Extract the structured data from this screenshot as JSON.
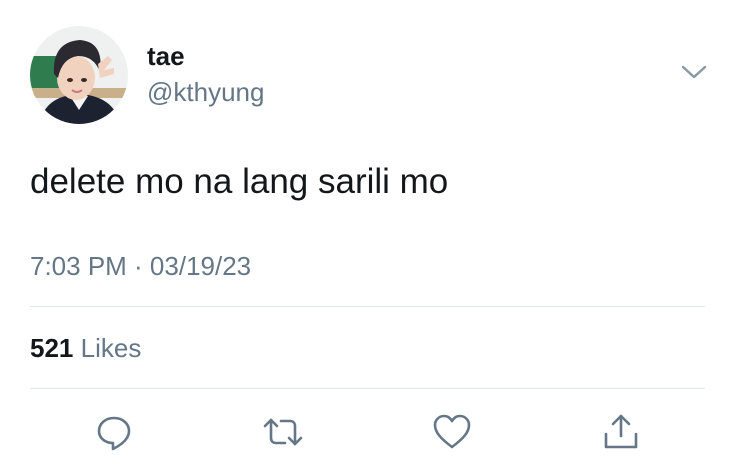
{
  "tweet": {
    "author": {
      "display_name": "tae",
      "handle": "@kthyung"
    },
    "text": "delete mo na lang sarili mo",
    "timestamp": "7:03 PM · 03/19/23",
    "stats": {
      "likes_count": "521",
      "likes_label": "Likes"
    },
    "actions": [
      {
        "name": "reply",
        "icon": "reply-icon"
      },
      {
        "name": "retweet",
        "icon": "retweet-icon"
      },
      {
        "name": "like",
        "icon": "heart-icon"
      },
      {
        "name": "share",
        "icon": "share-icon"
      }
    ],
    "menu_icon": "chevron-down-icon"
  },
  "colors": {
    "text_primary": "#14171a",
    "text_secondary": "#657786",
    "divider": "#e1e8ed",
    "background": "#ffffff"
  }
}
